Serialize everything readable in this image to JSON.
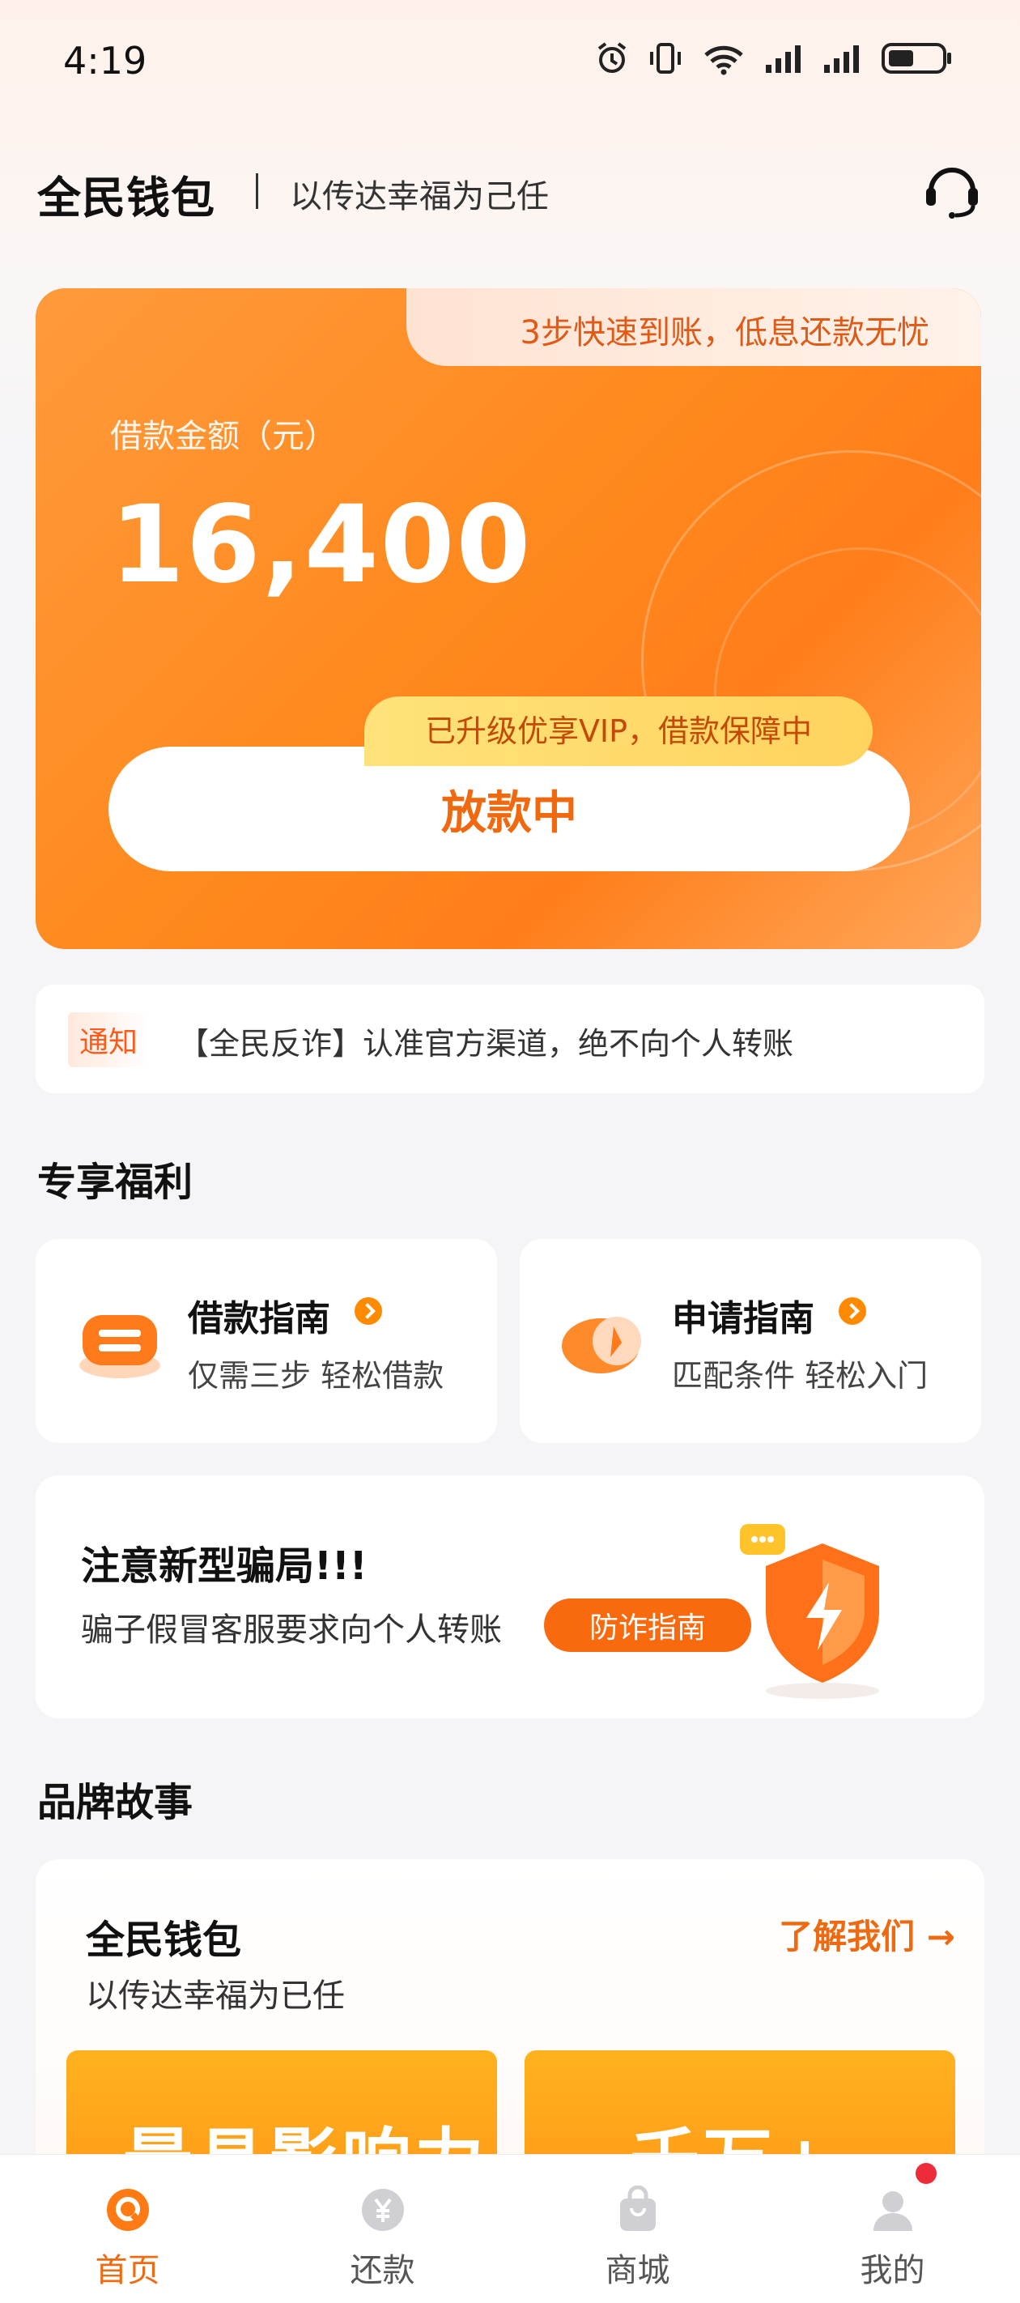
{
  "status_bar": {
    "time": "4:19",
    "icons": [
      "alarm-icon",
      "vibrate-icon",
      "wifi-6-icon",
      "signal-icon",
      "signal-icon",
      "battery-icon"
    ]
  },
  "header": {
    "title": "全民钱包",
    "slogan": "以传达幸福为己任",
    "icon": "customer-service-icon"
  },
  "hero": {
    "tagline": "3步快速到账，低息还款无忧",
    "amount_label": "借款金额（元）",
    "amount": "16,400",
    "vip_badge": "已升级优享VIP，借款保障中",
    "status_button": "放款中"
  },
  "notice": {
    "tag": "通知",
    "text": "【全民反诈】认准官方渠道，绝不向个人转账"
  },
  "benefits": {
    "section_title": "专享福利",
    "items": [
      {
        "title": "借款指南",
        "subtitle": "仅需三步 轻松借款",
        "icon": "loan-guide-icon"
      },
      {
        "title": "申请指南",
        "subtitle": "匹配条件 轻松入门",
        "icon": "apply-guide-icon"
      }
    ]
  },
  "scam_alert": {
    "title": "注意新型骗局!!!",
    "subtitle": "骗子假冒客服要求向个人转账",
    "button": "防诈指南",
    "icon": "shield-icon"
  },
  "brand": {
    "section_title": "品牌故事",
    "title": "全民钱包",
    "subtitle": "以传达幸福为已任",
    "link": "了解我们 →",
    "banners": [
      "最具影响力",
      "千万+"
    ]
  },
  "bottom_nav": {
    "items": [
      {
        "label": "首页",
        "icon": "home-icon",
        "active": true
      },
      {
        "label": "还款",
        "icon": "repay-icon",
        "active": false
      },
      {
        "label": "商城",
        "icon": "mall-icon",
        "active": false
      },
      {
        "label": "我的",
        "icon": "profile-icon",
        "active": false
      }
    ]
  },
  "colors": {
    "accent": "#ff8a1e",
    "accent_text": "#ef6a11",
    "badge": "#ffd35e",
    "notification_dot": "#ee2b3a"
  }
}
